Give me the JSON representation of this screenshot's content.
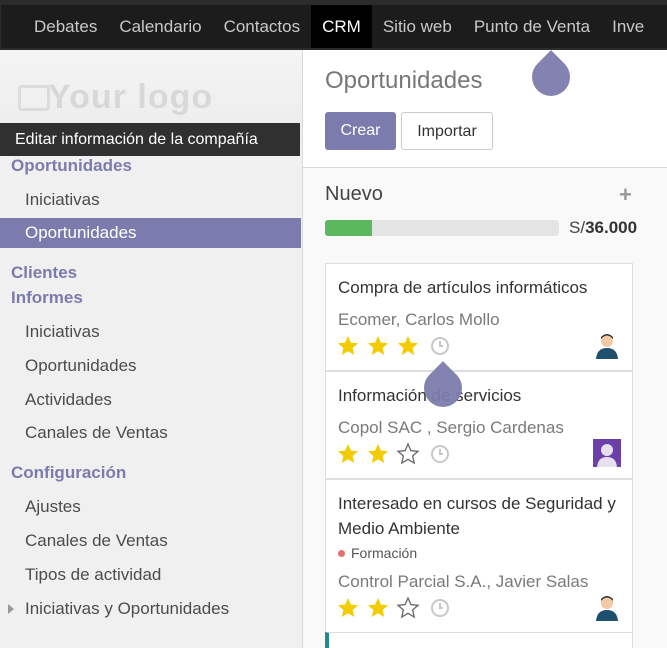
{
  "topnav": {
    "items": [
      {
        "label": "Debates",
        "active": false
      },
      {
        "label": "Calendario",
        "active": false
      },
      {
        "label": "Contactos",
        "active": false
      },
      {
        "label": "CRM",
        "active": true
      },
      {
        "label": "Sitio web",
        "active": false
      },
      {
        "label": "Punto de Venta",
        "active": false
      },
      {
        "label": "Inve",
        "active": false
      }
    ]
  },
  "sidebar": {
    "logo_text": "Your logo",
    "tooltip": "Editar información de la compañía",
    "sections": {
      "oportunidades": "Oportunidades",
      "clientes": "Clientes",
      "informes": "Informes",
      "configuracion": "Configuración"
    },
    "items": {
      "iniciativas": "Iniciativas",
      "oportunidades": "Oportunidades",
      "inf_iniciativas": "Iniciativas",
      "inf_oportunidades": "Oportunidades",
      "inf_actividades": "Actividades",
      "inf_canales": "Canales de Ventas",
      "cfg_ajustes": "Ajustes",
      "cfg_canales": "Canales de Ventas",
      "cfg_tipos": "Tipos de actividad",
      "cfg_iniciativas": "Iniciativas y Oportunidades"
    }
  },
  "main": {
    "title": "Oportunidades",
    "create_label": "Crear",
    "import_label": "Importar",
    "column": {
      "title": "Nuevo",
      "add_symbol": "+",
      "progress_fraction": 0.2,
      "currency": "S/",
      "total": "36.000"
    },
    "cards": [
      {
        "name": "Compra de artículos informáticos",
        "partner": "Ecomer, Carlos Mollo",
        "tag": "",
        "stars": 3
      },
      {
        "name": "Información de servicios",
        "partner": "Copol SAC , Sergio Cardenas",
        "tag": "",
        "stars": 2
      },
      {
        "name": "Interesado en cursos de Seguridad y Medio Ambiente",
        "partner": "Control Parcial S.A., Javier Salas",
        "tag": "Formación",
        "stars": 2
      }
    ]
  },
  "colors": {
    "accent": "#7c7bad",
    "progress": "#5cb85c",
    "star": "#f3cc00"
  }
}
